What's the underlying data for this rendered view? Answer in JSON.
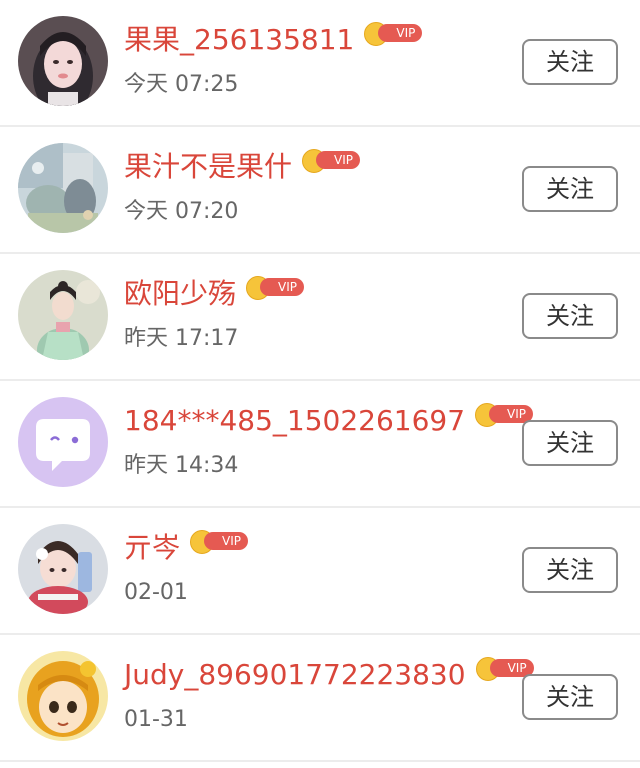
{
  "colors": {
    "name": "#d9463a",
    "time": "#666666",
    "vip_badge": "#e55a52",
    "crown": "#f6c43a",
    "button_border": "#8a8a8a",
    "divider": "#ececec"
  },
  "users": [
    {
      "name": "果果_256135811",
      "time": "今天 07:25",
      "vip": "VIP",
      "follow_label": "关注",
      "avatar_icon": "woman-portrait-avatar"
    },
    {
      "name": "果汁不是果什",
      "time": "今天 07:20",
      "vip": "VIP",
      "follow_label": "关注",
      "avatar_icon": "blurred-photo-avatar"
    },
    {
      "name": "欧阳少殇",
      "time": "昨天 17:17",
      "vip": "VIP",
      "follow_label": "关注",
      "avatar_icon": "hanfu-girl-avatar"
    },
    {
      "name": "184***485_1502261697",
      "time": "昨天 14:34",
      "vip": "VIP",
      "follow_label": "关注",
      "avatar_icon": "default-chat-bubble-avatar"
    },
    {
      "name": "亓岑",
      "time": "02-01",
      "vip": "VIP",
      "follow_label": "关注",
      "avatar_icon": "girl-with-flower-avatar"
    },
    {
      "name": "Judy_896901772223830",
      "time": "01-31",
      "vip": "VIP",
      "follow_label": "关注",
      "avatar_icon": "cartoon-girl-avatar"
    }
  ]
}
